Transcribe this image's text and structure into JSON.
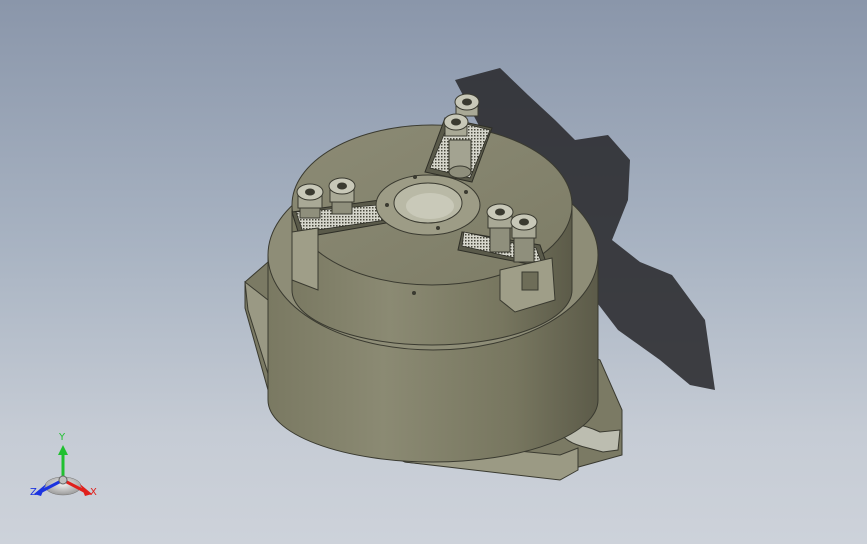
{
  "colors": {
    "background_top": "#8a96aa",
    "background_bottom": "#cdd2da",
    "part_body": "#86856f",
    "part_shadow": "#2a2a2e",
    "axis_x": "#e0201c",
    "axis_y": "#20c030",
    "axis_z": "#1c34e0"
  },
  "model": {
    "description_icon": "three-jaw-chuck-model",
    "jaw_count": 3,
    "bolts_per_jaw": 2
  },
  "triad": {
    "x_label": "X",
    "y_label": "Y",
    "z_label": "Z"
  }
}
